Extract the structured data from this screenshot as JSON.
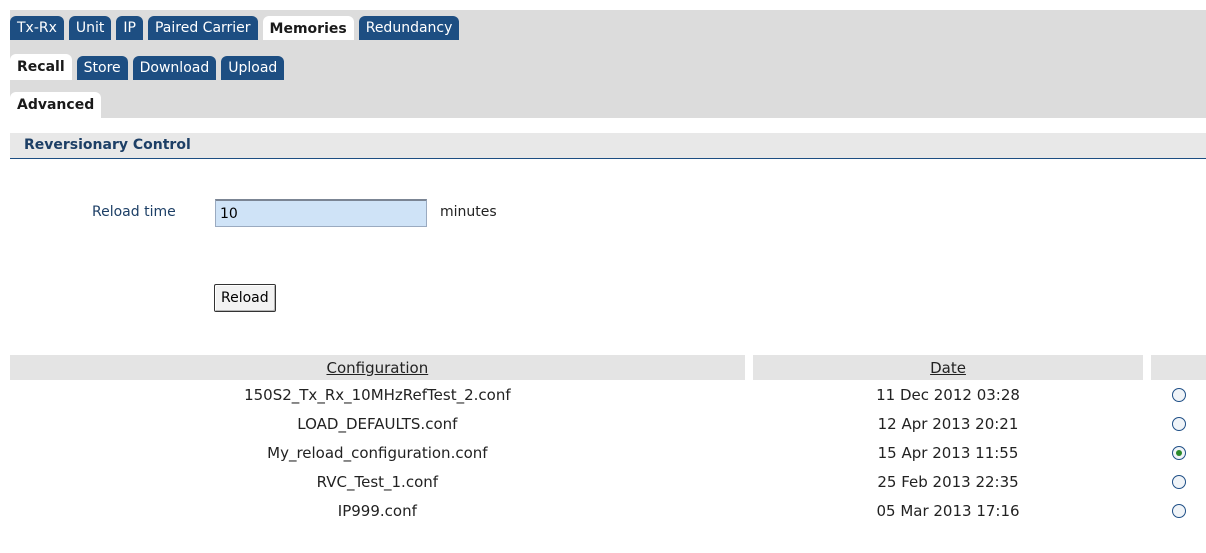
{
  "tabs": {
    "row1": [
      {
        "label": "Tx-Rx",
        "active": false
      },
      {
        "label": "Unit",
        "active": false
      },
      {
        "label": "IP",
        "active": false
      },
      {
        "label": "Paired Carrier",
        "active": false
      },
      {
        "label": "Memories",
        "active": true
      },
      {
        "label": "Redundancy",
        "active": false
      }
    ],
    "row2": [
      {
        "label": "Recall",
        "active": true
      },
      {
        "label": "Store",
        "active": false
      },
      {
        "label": "Download",
        "active": false
      },
      {
        "label": "Upload",
        "active": false
      }
    ],
    "row3": [
      {
        "label": "Advanced",
        "active": true
      }
    ]
  },
  "section": {
    "title": "Reversionary Control"
  },
  "reload": {
    "label": "Reload time",
    "value": "10",
    "unit": "minutes",
    "button_label": "Reload"
  },
  "table": {
    "headers": {
      "configuration": "Configuration",
      "date": "Date"
    },
    "rows": [
      {
        "name": "150S2_Tx_Rx_10MHzRefTest_2.conf",
        "date": "11 Dec 2012 03:28",
        "selected": false
      },
      {
        "name": "LOAD_DEFAULTS.conf",
        "date": "12 Apr 2013 20:21",
        "selected": false
      },
      {
        "name": "My_reload_configuration.conf",
        "date": "15 Apr 2013 11:55",
        "selected": true
      },
      {
        "name": "RVC_Test_1.conf",
        "date": "25 Feb 2013 22:35",
        "selected": false
      },
      {
        "name": "IP999.conf",
        "date": "05 Mar 2013 17:16",
        "selected": false
      }
    ]
  },
  "colors": {
    "tab_bg": "#1d4e82",
    "tab_area_bg": "#dcdcdc",
    "input_bg": "#cfe3f7",
    "radio_checked": "#2b8a2b"
  }
}
